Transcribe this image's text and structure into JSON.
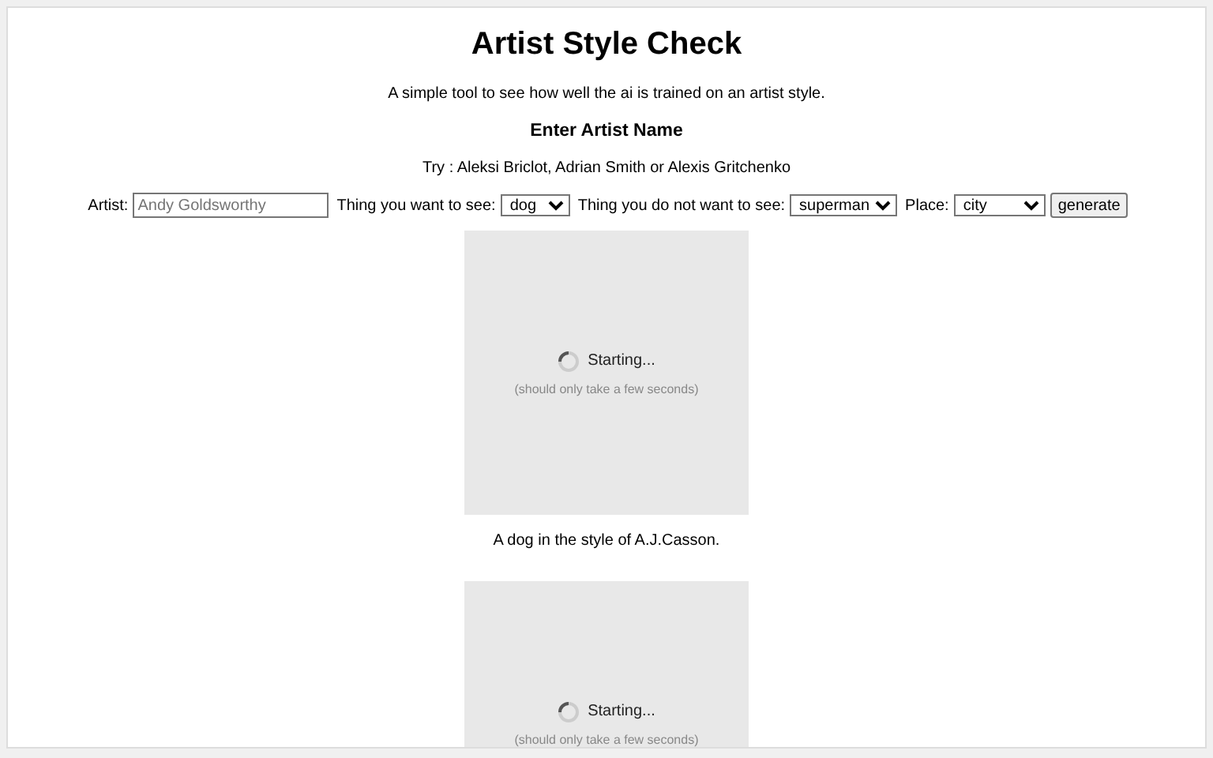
{
  "title": "Artist Style Check",
  "subtitle": "A simple tool to see how well the ai is trained on an artist style.",
  "heading": "Enter Artist Name",
  "hint": "Try : Aleksi Briclot, Adrian Smith or Alexis Gritchenko",
  "form": {
    "fields": [
      {
        "kind": "text",
        "label": "Artist:",
        "placeholder": "Andy Goldsworthy"
      },
      {
        "kind": "select",
        "label": "Thing you want to see:",
        "value": "dog"
      },
      {
        "kind": "select",
        "label": "Thing you do not want to see:",
        "value": "superman"
      },
      {
        "kind": "select",
        "label": "Place:",
        "value": "city"
      }
    ],
    "button": "generate"
  },
  "results": [
    {
      "status": "Starting...",
      "note": "(should only take a few seconds)",
      "caption": "A dog in the style of A.J.Casson."
    },
    {
      "status": "Starting...",
      "note": "(should only take a few seconds)"
    }
  ]
}
